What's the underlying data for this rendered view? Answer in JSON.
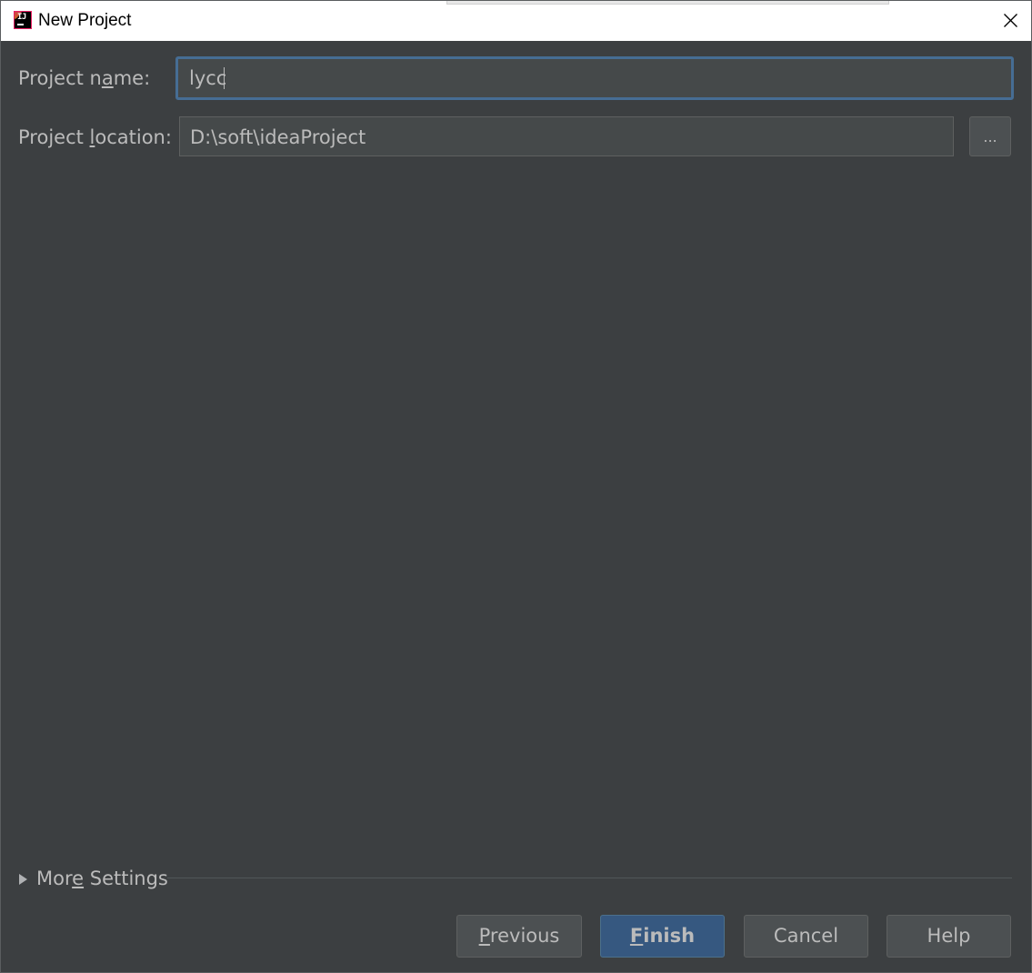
{
  "window": {
    "title": "New Project",
    "app_icon": "intellij-idea-icon",
    "close_icon": "close-icon"
  },
  "form": {
    "project_name": {
      "label_prefix": "Project n",
      "label_mnemonic": "a",
      "label_suffix": "me:",
      "value": "lycc"
    },
    "project_location": {
      "label_prefix": "Project ",
      "label_mnemonic": "l",
      "label_suffix": "ocation:",
      "value": "D:\\soft\\ideaProject",
      "browse_label": "..."
    }
  },
  "more_settings": {
    "label_prefix": "Mor",
    "label_mnemonic": "e",
    "label_suffix": " Settings",
    "expanded": false
  },
  "buttons": {
    "previous": {
      "mnemonic": "P",
      "rest": "revious"
    },
    "finish": {
      "mnemonic": "F",
      "rest": "inish"
    },
    "cancel": {
      "label": "Cancel"
    },
    "help": {
      "label": "Help"
    }
  },
  "colors": {
    "background": "#3c3f41",
    "field_background": "#45494a",
    "focus_border": "#466d94",
    "primary_button": "#365880",
    "text": "#bbbbbb"
  }
}
